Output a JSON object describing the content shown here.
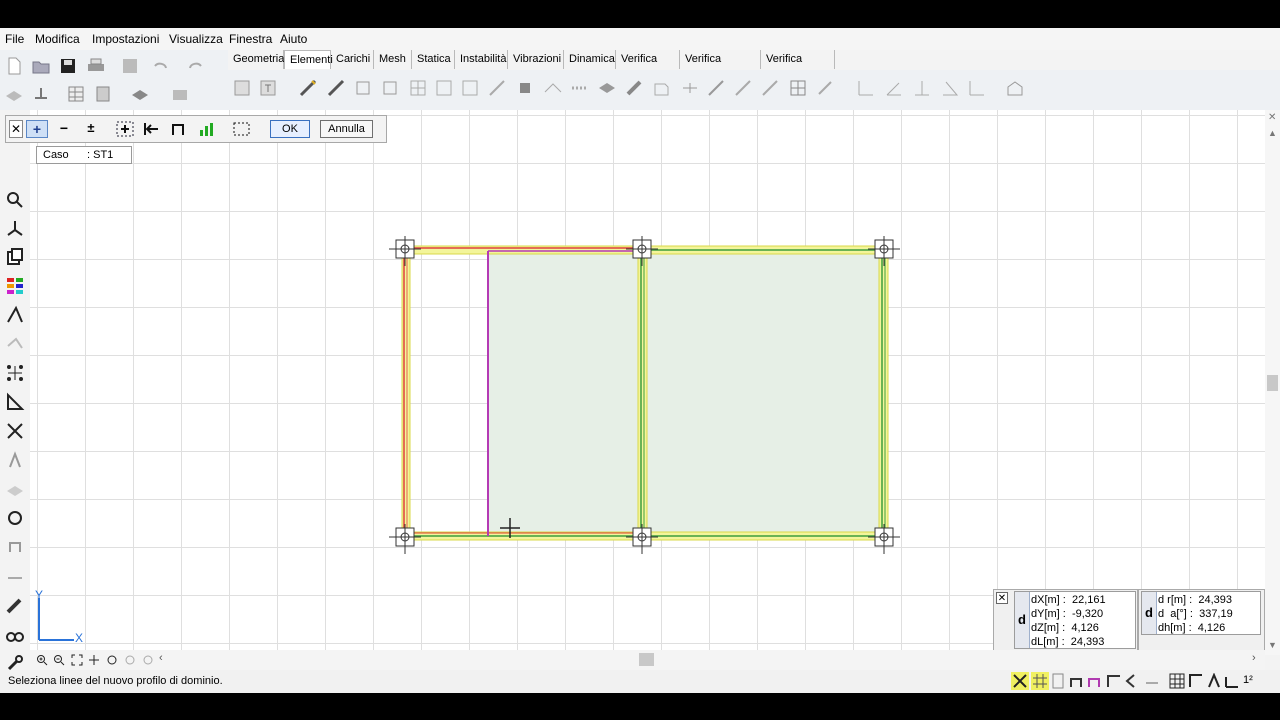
{
  "menu": [
    "File",
    "Modifica",
    "Impostazioni",
    "Visualizza",
    "Finestra",
    "Aiuto"
  ],
  "tabs": [
    "Geometria",
    "Elementi",
    "Carichi",
    "Mesh",
    "Statica",
    "Instabilità",
    "Vibrazioni",
    "Dinamica",
    "Verifica CA",
    "Verifica acciaio",
    "Verifica legno"
  ],
  "active_tab": "Elementi",
  "float_toolbar": {
    "close": "✕",
    "plus": "+",
    "minus": "−",
    "plusminus": "±",
    "ok_label": "OK",
    "cancel_label": "Annulla"
  },
  "case_box": {
    "label": "Caso",
    "value": ": ST1"
  },
  "axes": {
    "y": "Y",
    "x": "X"
  },
  "measure_left": {
    "label": "d",
    "close": "✕",
    "rows": [
      "dX[m] :  22,161",
      "dY[m] :  -9,320",
      "dZ[m] :  4,126",
      "dL[m] :  24,393"
    ]
  },
  "measure_right": {
    "label": "d",
    "rows": [
      "d r[m] :  24,393",
      "d  a[°] :  337,19",
      "dh[m] :  4,126"
    ]
  },
  "status": {
    "message": "Seleziona linee del nuovo profilo di dominio."
  },
  "colors": {
    "beam_yellow": "#e7e95a",
    "beam_green": "#3c9d3c",
    "beam_red": "#e0403c",
    "beam_magenta": "#b43ab4",
    "slab_fill": "#e6efe6"
  }
}
